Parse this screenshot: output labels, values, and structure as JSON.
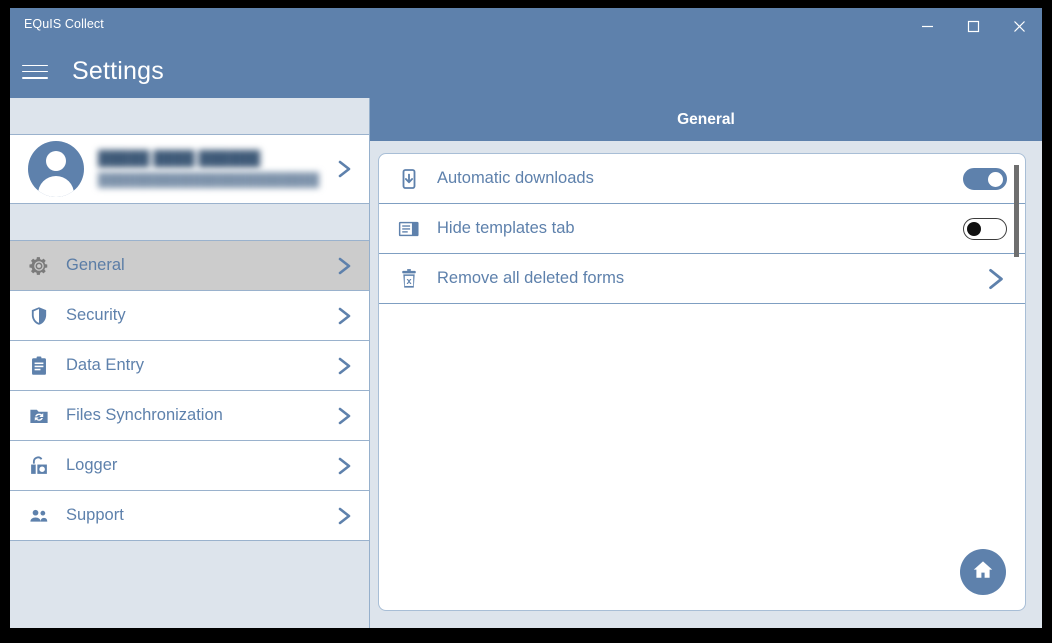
{
  "window": {
    "app_title": "EQuIS Collect",
    "controls": [
      {
        "name": "minimize",
        "label": "–"
      },
      {
        "name": "maximize",
        "label": "□"
      },
      {
        "name": "close",
        "label": "✕"
      }
    ]
  },
  "appbar": {
    "menu_icon": "hamburger-menu-icon",
    "page_title": "Settings"
  },
  "sidebar": {
    "profile": {
      "avatar_icon": "user-avatar-icon",
      "name": "█████ ████ ██████",
      "email": "████████████████████████",
      "chevron_icon": "chevron-right-icon"
    },
    "items": [
      {
        "label": "General",
        "icon": "gear-icon",
        "selected": true
      },
      {
        "label": "Security",
        "icon": "shield-icon",
        "selected": false
      },
      {
        "label": "Data Entry",
        "icon": "clipboard-icon",
        "selected": false
      },
      {
        "label": "Files Synchronization",
        "icon": "folder-sync-icon",
        "selected": false
      },
      {
        "label": "Logger",
        "icon": "logger-icon",
        "selected": false
      },
      {
        "label": "Support",
        "icon": "people-icon",
        "selected": false
      }
    ]
  },
  "content": {
    "header_title": "General",
    "settings": [
      {
        "label": "Automatic downloads",
        "icon": "device-download-icon",
        "control": "toggle",
        "toggle_state": "on"
      },
      {
        "label": "Hide templates tab",
        "icon": "templates-panel-icon",
        "control": "toggle",
        "toggle_state": "off"
      },
      {
        "label": "Remove all deleted forms",
        "icon": "trash-x-icon",
        "control": "chevron",
        "chevron_icon": "chevron-right-icon"
      }
    ],
    "fab": {
      "icon": "home-icon"
    }
  },
  "colors": {
    "accent_blue": "#5e81ac",
    "sidebar_bg": "#dde4ec",
    "selected_row": "#cccccc",
    "card_border": "#a8bed6",
    "text_blue": "#5e81ac"
  }
}
